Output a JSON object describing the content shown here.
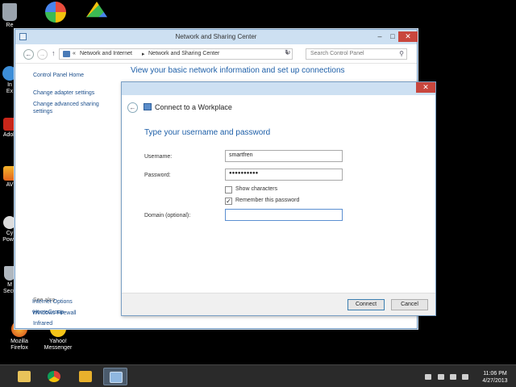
{
  "desktop": {
    "icons": [
      {
        "label": "Re"
      },
      {
        "label": "In\nEx"
      },
      {
        "label": "Adob"
      },
      {
        "label": "AV"
      },
      {
        "label": "Cy\nPowe"
      },
      {
        "label": "M\nSecu"
      },
      {
        "label": "Mozilla\nFirefox"
      },
      {
        "label": "Yahoo!\nMessenger"
      }
    ]
  },
  "window": {
    "title": "Network and Sharing Center",
    "minimize": "–",
    "maximize": "□",
    "close": "✕",
    "address": {
      "sep0": "«",
      "crumb1": "Network and Internet",
      "sep1": "▸",
      "crumb2": "Network and Sharing Center"
    },
    "search_placeholder": "Search Control Panel",
    "left_pane": {
      "home": "Control Panel Home",
      "links": [
        "Change adapter settings",
        "Change advanced sharing settings"
      ],
      "see_also_label": "See also",
      "see_also": [
        "HomeGroup",
        "Infrared",
        "Internet Options",
        "Windows Firewall"
      ]
    },
    "heading": "View your basic network information and set up connections"
  },
  "dialog": {
    "close": "✕",
    "title": "Connect to a Workplace",
    "heading": "Type your username and password",
    "username_label": "Username:",
    "username_value": "smartfren",
    "password_label": "Password:",
    "password_value": "●●●●●●●●●●",
    "show_characters": "Show characters",
    "show_characters_checked": false,
    "remember_password": "Remember this password",
    "remember_password_checked": true,
    "domain_label": "Domain (optional):",
    "domain_value": "",
    "connect": "Connect",
    "cancel": "Cancel"
  },
  "taskbar": {
    "time": "11:06 PM",
    "date": "4/27/2013"
  },
  "colors": {
    "accent": "#1e5fa8",
    "link": "#1c4f8c",
    "titlebar": "#cde0f2",
    "close": "#c8463d"
  }
}
